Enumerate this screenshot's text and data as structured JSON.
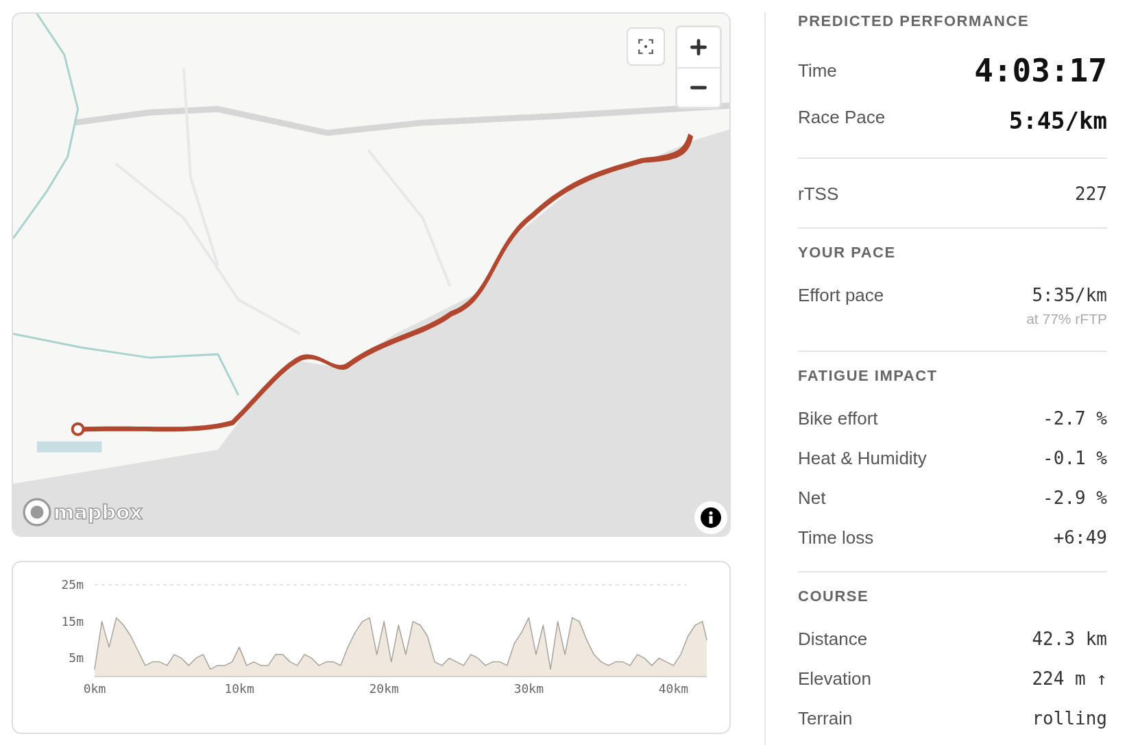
{
  "map": {
    "kind": "picture",
    "attribution_logo": "mapbox"
  },
  "elevation": {
    "chart_data": {
      "type": "area",
      "x": [
        0,
        0.5,
        1,
        1.5,
        2,
        2.5,
        3,
        3.5,
        4,
        4.5,
        5,
        5.5,
        6,
        6.5,
        7,
        7.5,
        8,
        8.5,
        9,
        9.5,
        10,
        10.5,
        11,
        11.5,
        12,
        12.5,
        13,
        13.5,
        14,
        14.5,
        15,
        15.5,
        16,
        16.5,
        17,
        17.5,
        18,
        18.5,
        19,
        19.5,
        20,
        20.5,
        21,
        21.5,
        22,
        22.5,
        23,
        23.5,
        24,
        24.5,
        25,
        25.5,
        26,
        26.5,
        27,
        27.5,
        28,
        28.5,
        29,
        29.5,
        30,
        30.5,
        31,
        31.5,
        32,
        32.5,
        33,
        33.5,
        34,
        34.5,
        35,
        35.5,
        36,
        36.5,
        37,
        37.5,
        38,
        38.5,
        39,
        39.5,
        40,
        40.5,
        41,
        41.5,
        42,
        42.3
      ],
      "series": [
        {
          "color": "#a8a29a",
          "values": [
            2,
            15,
            8,
            16,
            14,
            11,
            7,
            3,
            4,
            4,
            3,
            6,
            5,
            3,
            5,
            6,
            2,
            3,
            3,
            4,
            8,
            3,
            4,
            3,
            3,
            6,
            6,
            4,
            3,
            6,
            5,
            3,
            4,
            4,
            3,
            8,
            12,
            15,
            16,
            6,
            15,
            4,
            14,
            6,
            15,
            14,
            11,
            4,
            3,
            5,
            4,
            3,
            6,
            5,
            3,
            4,
            4,
            3,
            9,
            12,
            16,
            6,
            14,
            2,
            15,
            6,
            16,
            15,
            10,
            6,
            4,
            3,
            4,
            4,
            3,
            6,
            5,
            3,
            5,
            4,
            3,
            6,
            11,
            14,
            15,
            10
          ]
        }
      ],
      "ylim": [
        0,
        25
      ],
      "yticks": [
        {
          "value": 5,
          "label": "5m"
        },
        {
          "value": 15,
          "label": "15m"
        },
        {
          "value": 25,
          "label": "25m"
        }
      ],
      "xlim": [
        0,
        42.3
      ],
      "xticks": [
        {
          "value": 0,
          "label": "0km"
        },
        {
          "value": 10,
          "label": "10km"
        },
        {
          "value": 20,
          "label": "20km"
        },
        {
          "value": 30,
          "label": "30km"
        },
        {
          "value": 40,
          "label": "40km"
        }
      ]
    }
  },
  "sections": [
    {
      "heading": "PREDICTED PERFORMANCE",
      "rows": [
        {
          "label": "Time",
          "value": "4:03:17",
          "kind": "hero"
        },
        {
          "label": "Race Pace",
          "value": "5:45/km",
          "kind": "strong"
        }
      ]
    },
    {
      "rows": [
        {
          "label": "rTSS",
          "value": "227",
          "kind": "plain"
        }
      ]
    },
    {
      "heading": "YOUR PACE",
      "rows": [
        {
          "label": "Effort pace",
          "value": "5:35/km",
          "note": "at 77% rFTP",
          "kind": "plain"
        }
      ]
    },
    {
      "heading": "FATIGUE IMPACT",
      "rows": [
        {
          "label": "Bike effort",
          "value": "-2.7 %",
          "kind": "plain"
        },
        {
          "label": "Heat & Humidity",
          "value": "-0.1 %",
          "kind": "plain"
        },
        {
          "label": "Net",
          "value": "-2.9 %",
          "kind": "plain"
        },
        {
          "label": "Time loss",
          "value": "+6:49",
          "kind": "plain"
        }
      ]
    },
    {
      "heading": "COURSE",
      "rows": [
        {
          "label": "Distance",
          "value": "42.3 km",
          "kind": "plain"
        },
        {
          "label": "Elevation",
          "value": "224 m ↑",
          "kind": "plain"
        },
        {
          "label": "Terrain",
          "value": "rolling",
          "kind": "plain"
        }
      ]
    }
  ]
}
